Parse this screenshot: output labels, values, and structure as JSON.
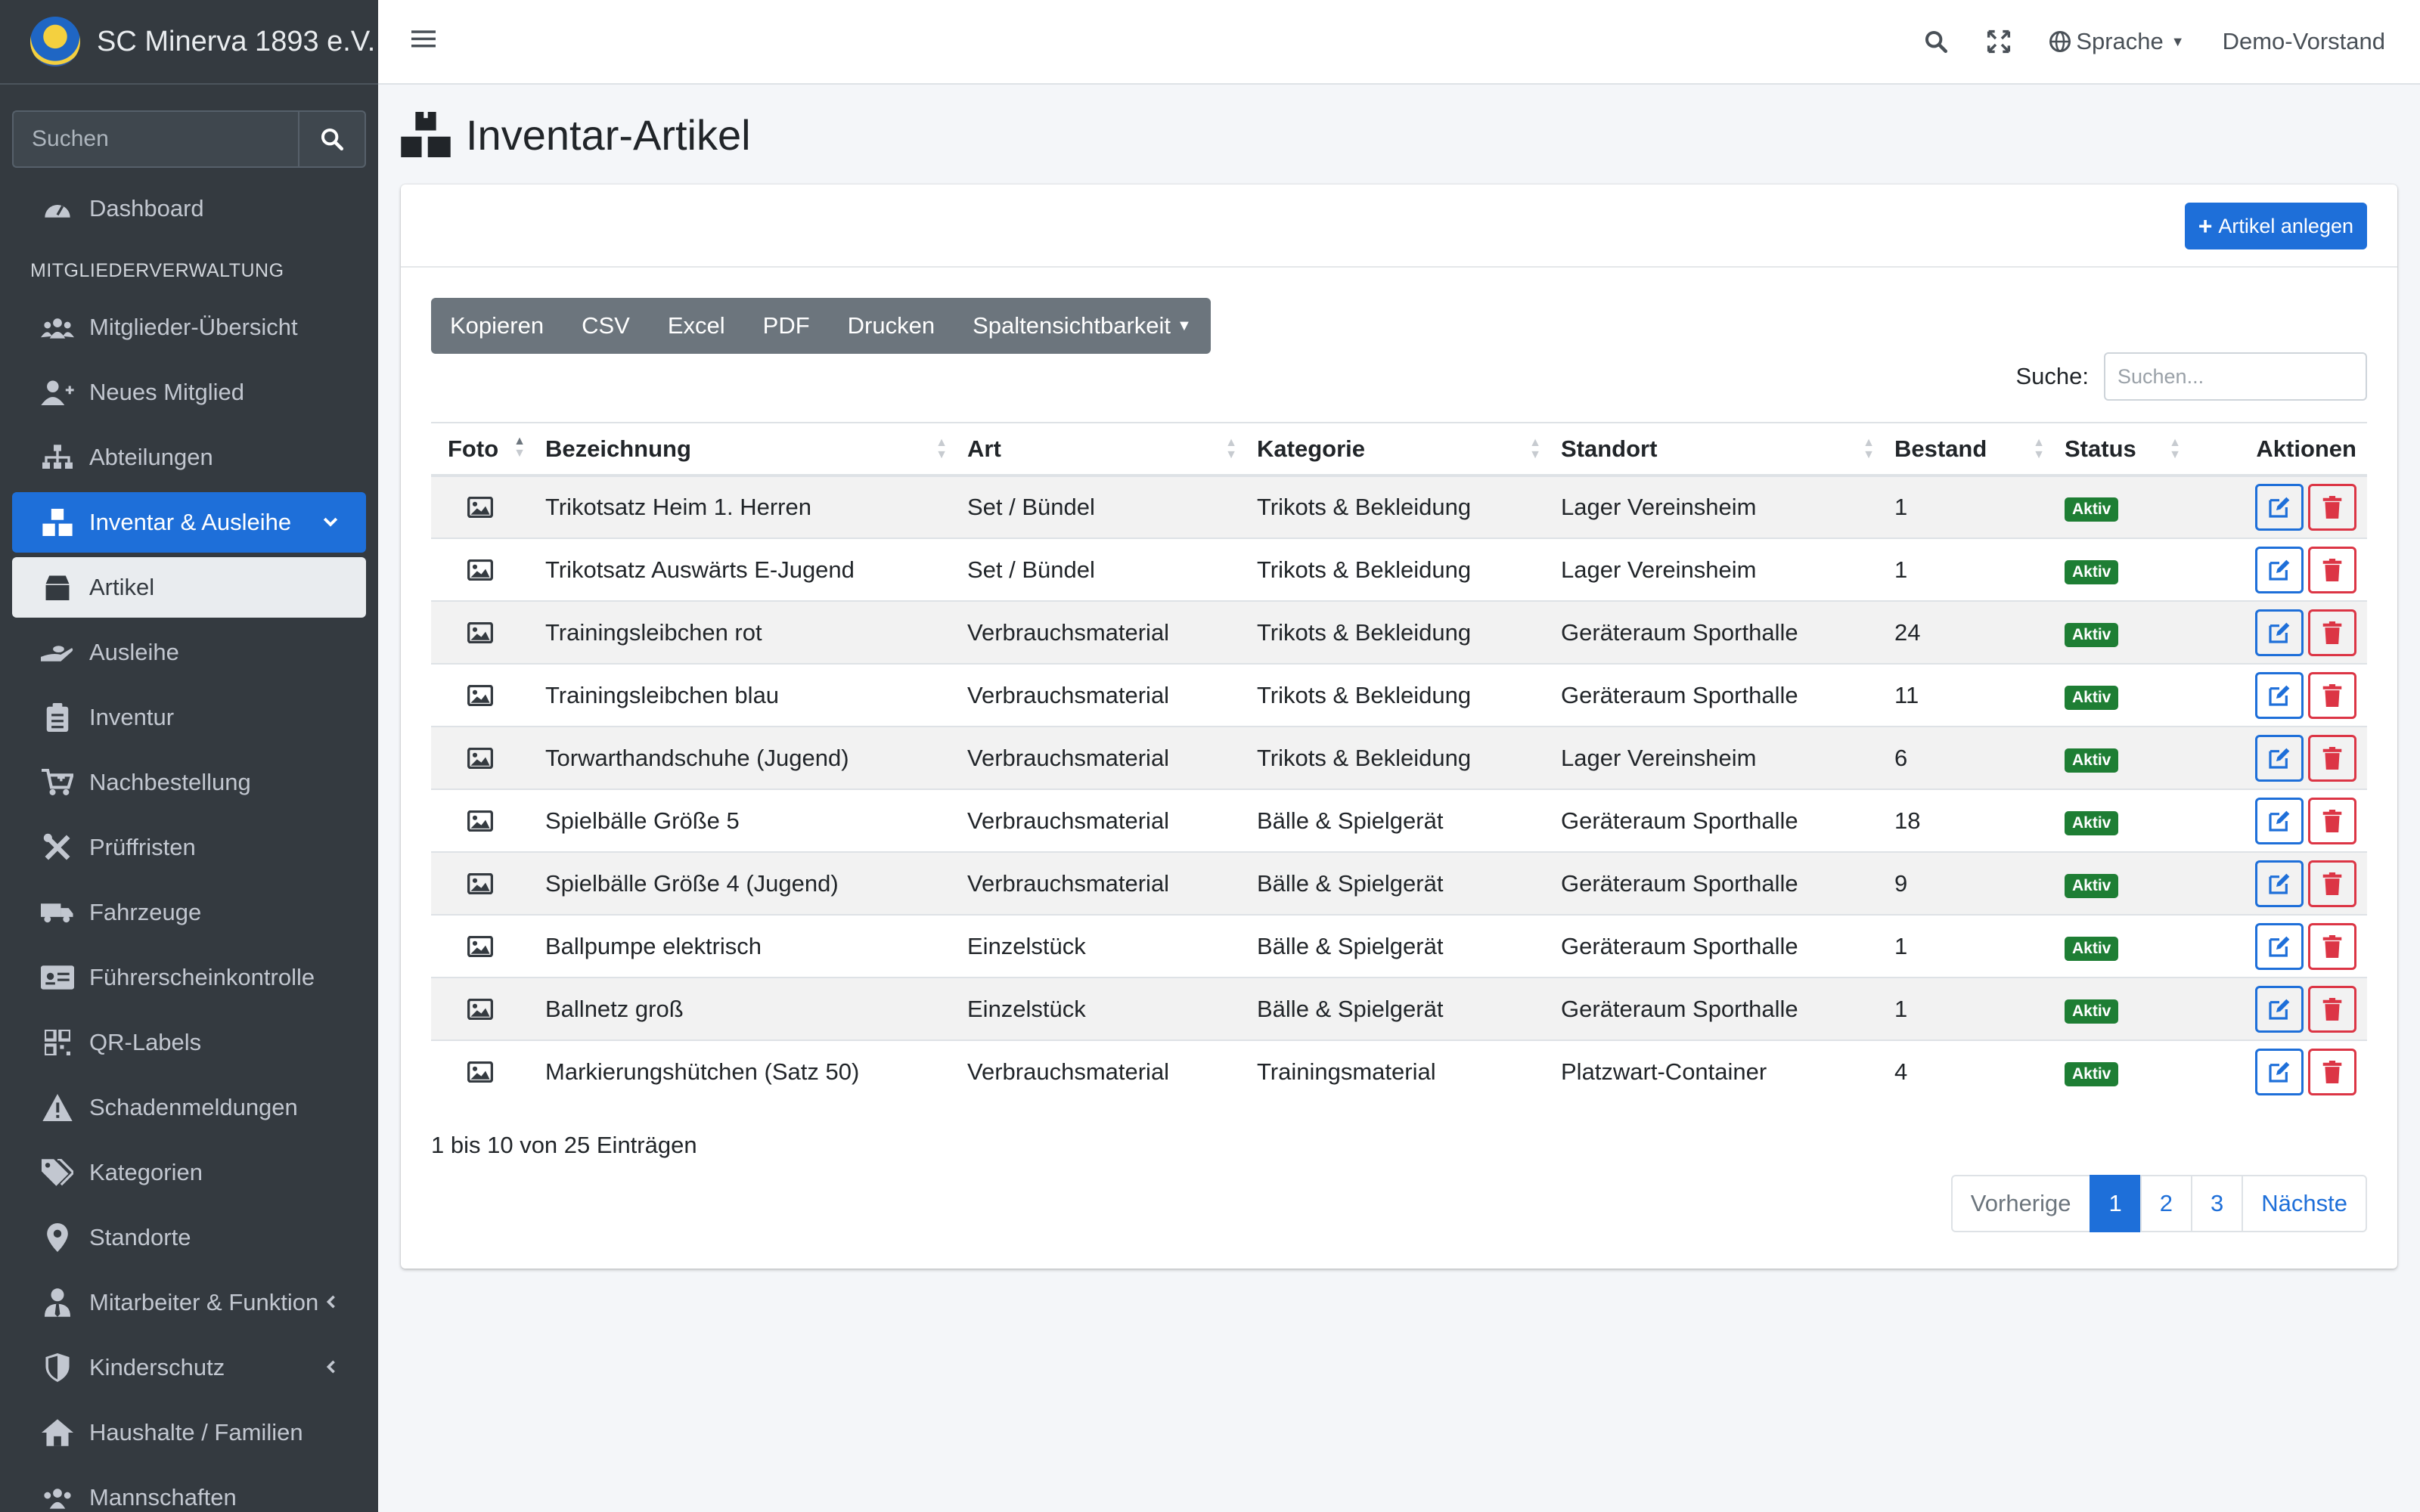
{
  "brand": {
    "name": "SC Minerva 1893 e.V."
  },
  "sidebar": {
    "search_placeholder": "Suchen",
    "dashboard": "Dashboard",
    "section_header": "MITGLIEDERVERWALTUNG",
    "items": [
      {
        "label": "Mitglieder-Übersicht",
        "icon": "users-icon"
      },
      {
        "label": "Neues Mitglied",
        "icon": "user-plus-icon"
      },
      {
        "label": "Abteilungen",
        "icon": "sitemap-icon"
      },
      {
        "label": "Inventar & Ausleihe",
        "icon": "boxes-icon"
      },
      {
        "label": "Artikel",
        "icon": "box-icon"
      },
      {
        "label": "Ausleihe",
        "icon": "hand-holding-icon"
      },
      {
        "label": "Inventur",
        "icon": "clipboard-list-icon"
      },
      {
        "label": "Nachbestellung",
        "icon": "cart-plus-icon"
      },
      {
        "label": "Prüffristen",
        "icon": "tools-icon"
      },
      {
        "label": "Fahrzeuge",
        "icon": "truck-icon"
      },
      {
        "label": "Führerscheinkontrolle",
        "icon": "id-card-icon"
      },
      {
        "label": "QR-Labels",
        "icon": "qrcode-icon"
      },
      {
        "label": "Schadenmeldungen",
        "icon": "warning-icon"
      },
      {
        "label": "Kategorien",
        "icon": "tags-icon"
      },
      {
        "label": "Standorte",
        "icon": "map-marker-icon"
      },
      {
        "label": "Mitarbeiter & Funktion",
        "icon": "user-tie-icon"
      },
      {
        "label": "Kinderschutz",
        "icon": "shield-icon"
      },
      {
        "label": "Haushalte / Familien",
        "icon": "home-icon"
      },
      {
        "label": "Mannschaften",
        "icon": "team-icon"
      }
    ]
  },
  "topbar": {
    "language": "Sprache",
    "user": "Demo-Vorstand"
  },
  "page": {
    "title": "Inventar-Artikel"
  },
  "card": {
    "add_button": "Artikel anlegen"
  },
  "datatable": {
    "buttons": [
      "Kopieren",
      "CSV",
      "Excel",
      "PDF",
      "Drucken",
      "Spaltensichtbarkeit"
    ],
    "search_label": "Suche:",
    "search_placeholder": "Suchen...",
    "columns": [
      "Foto",
      "Bezeichnung",
      "Art",
      "Kategorie",
      "Standort",
      "Bestand",
      "Status",
      "Aktionen"
    ],
    "rows": [
      {
        "name": "Trikotsatz Heim 1. Herren",
        "art": "Set / Bündel",
        "kategorie": "Trikots & Bekleidung",
        "standort": "Lager Vereinsheim",
        "bestand": "1",
        "status": "Aktiv"
      },
      {
        "name": "Trikotsatz Auswärts E-Jugend",
        "art": "Set / Bündel",
        "kategorie": "Trikots & Bekleidung",
        "standort": "Lager Vereinsheim",
        "bestand": "1",
        "status": "Aktiv"
      },
      {
        "name": "Trainingsleibchen rot",
        "art": "Verbrauchsmaterial",
        "kategorie": "Trikots & Bekleidung",
        "standort": "Geräteraum Sporthalle",
        "bestand": "24",
        "status": "Aktiv"
      },
      {
        "name": "Trainingsleibchen blau",
        "art": "Verbrauchsmaterial",
        "kategorie": "Trikots & Bekleidung",
        "standort": "Geräteraum Sporthalle",
        "bestand": "11",
        "status": "Aktiv"
      },
      {
        "name": "Torwarthandschuhe (Jugend)",
        "art": "Verbrauchsmaterial",
        "kategorie": "Trikots & Bekleidung",
        "standort": "Lager Vereinsheim",
        "bestand": "6",
        "status": "Aktiv"
      },
      {
        "name": "Spielbälle Größe 5",
        "art": "Verbrauchsmaterial",
        "kategorie": "Bälle & Spielgerät",
        "standort": "Geräteraum Sporthalle",
        "bestand": "18",
        "status": "Aktiv"
      },
      {
        "name": "Spielbälle Größe 4 (Jugend)",
        "art": "Verbrauchsmaterial",
        "kategorie": "Bälle & Spielgerät",
        "standort": "Geräteraum Sporthalle",
        "bestand": "9",
        "status": "Aktiv"
      },
      {
        "name": "Ballpumpe elektrisch",
        "art": "Einzelstück",
        "kategorie": "Bälle & Spielgerät",
        "standort": "Geräteraum Sporthalle",
        "bestand": "1",
        "status": "Aktiv"
      },
      {
        "name": "Ballnetz groß",
        "art": "Einzelstück",
        "kategorie": "Bälle & Spielgerät",
        "standort": "Geräteraum Sporthalle",
        "bestand": "1",
        "status": "Aktiv"
      },
      {
        "name": "Markierungshütchen (Satz 50)",
        "art": "Verbrauchsmaterial",
        "kategorie": "Trainingsmaterial",
        "standort": "Platzwart-Container",
        "bestand": "4",
        "status": "Aktiv"
      }
    ],
    "info": "1 bis 10 von 25 Einträgen",
    "pagination": {
      "prev": "Vorherige",
      "pages": [
        "1",
        "2",
        "3"
      ],
      "next": "Nächste",
      "current": "1"
    }
  },
  "colors": {
    "sidebar_bg": "#343a40",
    "primary": "#1e6fd9",
    "danger": "#dc3545",
    "success": "#1e7e34"
  }
}
